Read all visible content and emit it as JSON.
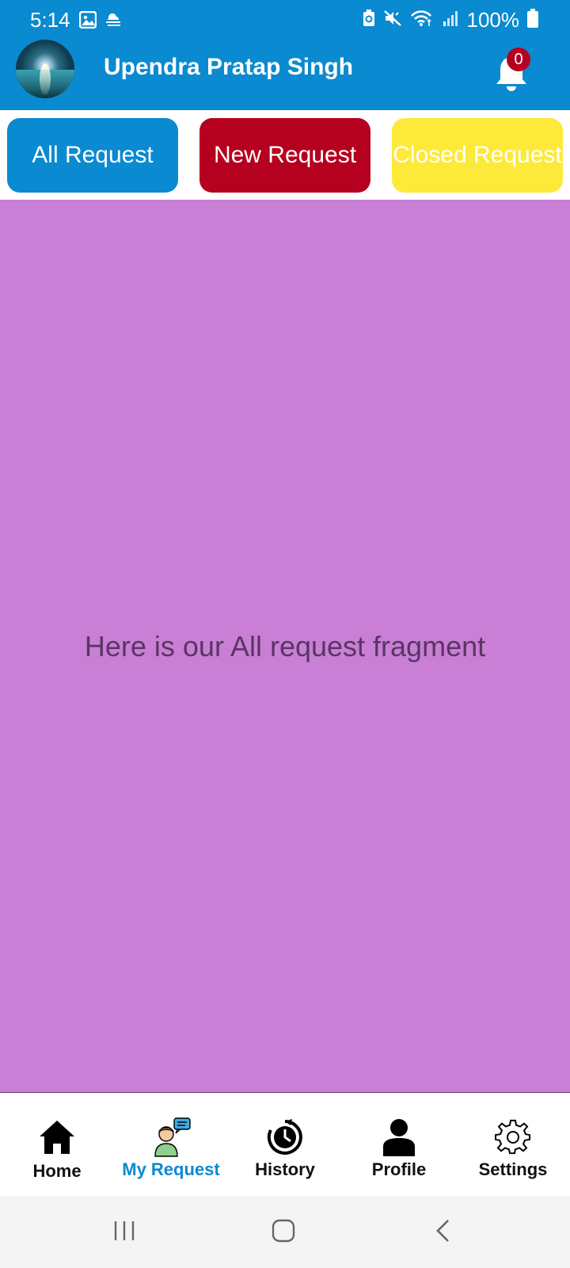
{
  "status_bar": {
    "time": "5:14",
    "battery": "100%",
    "icons_left": [
      "image-icon",
      "weather-fog-icon"
    ],
    "icons_right": [
      "battery-saver-icon",
      "mute-icon",
      "wifi-icon",
      "signal-icon",
      "battery-icon"
    ]
  },
  "header": {
    "user_name": "Upendra Pratap Singh",
    "notification_count": "0",
    "background_color": "#0a8ad0"
  },
  "segments": {
    "all_label": "All Request",
    "new_label": "New Request",
    "closed_label": "Closed Request",
    "colors": {
      "all": "#0a8ad0",
      "new": "#b5001f",
      "closed": "#fde93a"
    }
  },
  "fragment": {
    "text": "Here is our All request fragment",
    "background_color": "#c97fd6"
  },
  "bottom_nav": {
    "items": [
      {
        "label": "Home",
        "icon": "home-icon"
      },
      {
        "label": "My Request",
        "icon": "support-agent-icon",
        "active": true
      },
      {
        "label": "History",
        "icon": "history-icon"
      },
      {
        "label": "Profile",
        "icon": "profile-icon"
      },
      {
        "label": "Settings",
        "icon": "gear-icon"
      }
    ]
  },
  "system_nav": {
    "buttons": [
      "recents-icon",
      "home-circle-icon",
      "back-icon"
    ]
  }
}
